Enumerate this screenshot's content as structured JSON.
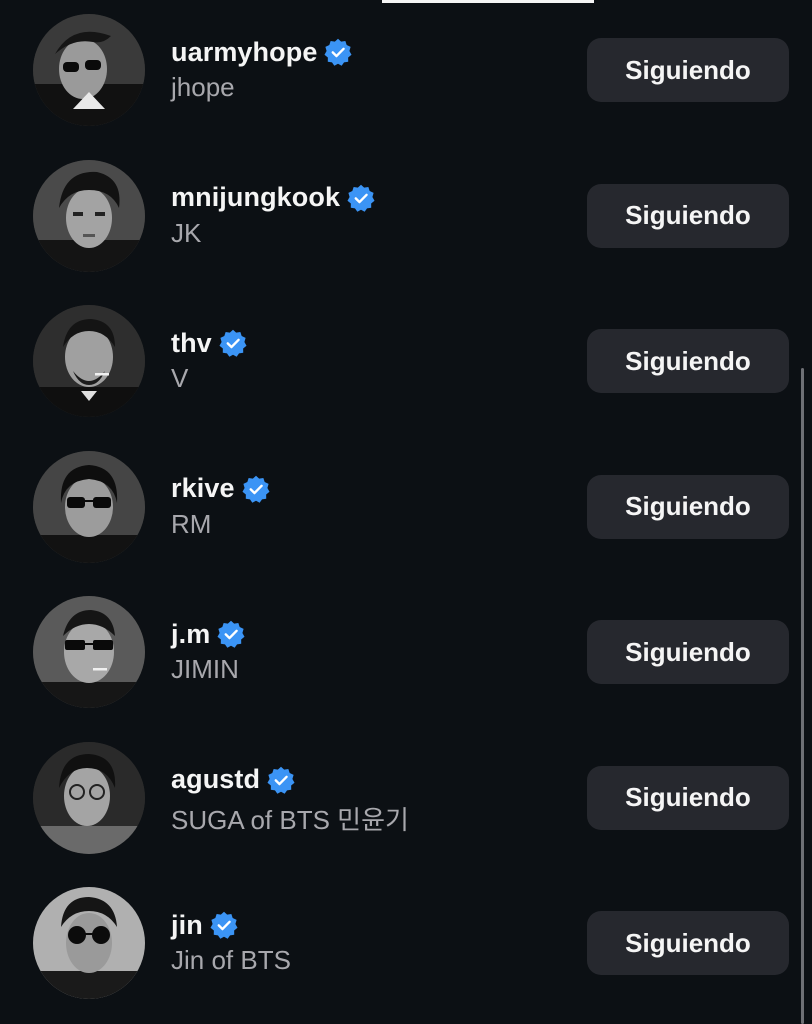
{
  "accent_verified": "#3b94f5",
  "follow_list": [
    {
      "username": "uarmyhope",
      "full_name": "jhope",
      "verified": true,
      "button_label": "Siguiendo"
    },
    {
      "username": "mnijungkook",
      "full_name": "JK",
      "verified": true,
      "button_label": "Siguiendo"
    },
    {
      "username": "thv",
      "full_name": "V",
      "verified": true,
      "button_label": "Siguiendo"
    },
    {
      "username": "rkive",
      "full_name": "RM",
      "verified": true,
      "button_label": "Siguiendo"
    },
    {
      "username": "j.m",
      "full_name": "JIMIN",
      "verified": true,
      "button_label": "Siguiendo"
    },
    {
      "username": "agustd",
      "full_name": "SUGA of BTS 민윤기",
      "verified": true,
      "button_label": "Siguiendo"
    },
    {
      "username": "jin",
      "full_name": "Jin of BTS",
      "verified": true,
      "button_label": "Siguiendo"
    }
  ]
}
